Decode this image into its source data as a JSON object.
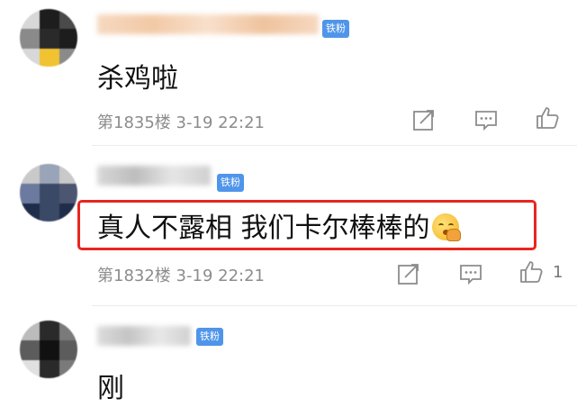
{
  "comments": [
    {
      "content": "杀鸡啦",
      "floor": "第1835楼",
      "date": "3-19 22:21",
      "badge": "铁粉",
      "likes": "",
      "avatar_colors": [
        "#1d1d1d",
        "#4a4a4a",
        "#d8d8d8",
        "#f1c232",
        "#8a8a8a",
        "#2a2a2a"
      ]
    },
    {
      "content": "真人不露相 我们卡尔棒棒的",
      "floor": "第1832楼",
      "date": "3-19 22:21",
      "badge": "铁粉",
      "likes": "1",
      "highlighted": true,
      "avatar_colors": [
        "#3a4a66",
        "#6d7aa0",
        "#c9c9c9",
        "#1f2c4a",
        "#9aa4b8",
        "#4c5670"
      ]
    },
    {
      "content": "刚",
      "badge": "铁粉",
      "avatar_colors": [
        "#2a2a2a",
        "#5c5c5c",
        "#bcbcbc",
        "#111111",
        "#7a7a7a",
        "#e0e0e0"
      ]
    }
  ],
  "icons": {
    "share": "share-icon",
    "reply": "reply-icon",
    "like": "thumbs-up-icon"
  },
  "colors": {
    "badge": "#4f95ea",
    "highlight_border": "#e8261f",
    "meta_text": "#8c8c8c"
  }
}
